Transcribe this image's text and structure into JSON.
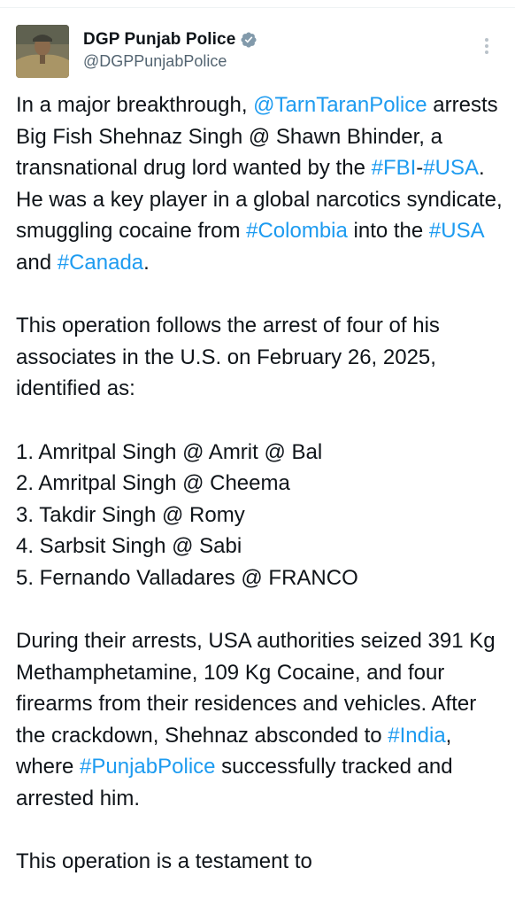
{
  "author": {
    "display_name": "DGP Punjab Police",
    "handle": "@DGPPunjabPolice",
    "verified": true
  },
  "colors": {
    "link": "#1d9bf0",
    "text": "#0f1419",
    "muted": "#536471"
  },
  "tweet": {
    "p1": {
      "t1": "In a major breakthrough, ",
      "m1": "@TarnTaranPolice",
      "t2": " arrests Big Fish Shehnaz Singh @ Shawn Bhinder, a transnational drug lord wanted by the ",
      "h1": "#FBI",
      "t3": "-",
      "h2": "#USA",
      "t4": ". He was a key player in a global narcotics syndicate, smuggling cocaine from ",
      "h3": "#Colombia",
      "t5": " into the ",
      "h4": "#USA",
      "t6": " and ",
      "h5": "#Canada",
      "t7": "."
    },
    "p2": "This operation follows the arrest of four of his associates in the U.S. on February 26, 2025, identified as:",
    "list": [
      "1. Amritpal Singh @ Amrit @ Bal",
      "2. Amritpal Singh @ Cheema",
      "3. Takdir Singh @ Romy",
      "4. Sarbsit Singh @ Sabi",
      "5. Fernando Valladares @ FRANCO"
    ],
    "p3": {
      "t1": "During their arrests, USA authorities seized 391 Kg Methamphetamine, 109 Kg Cocaine, and four firearms from their residences and vehicles. After the crackdown, Shehnaz absconded to ",
      "h1": "#India",
      "t2": ", where ",
      "h2": "#PunjabPolice",
      "t3": " successfully tracked and arrested him."
    },
    "p4": "This operation is a testament to"
  }
}
